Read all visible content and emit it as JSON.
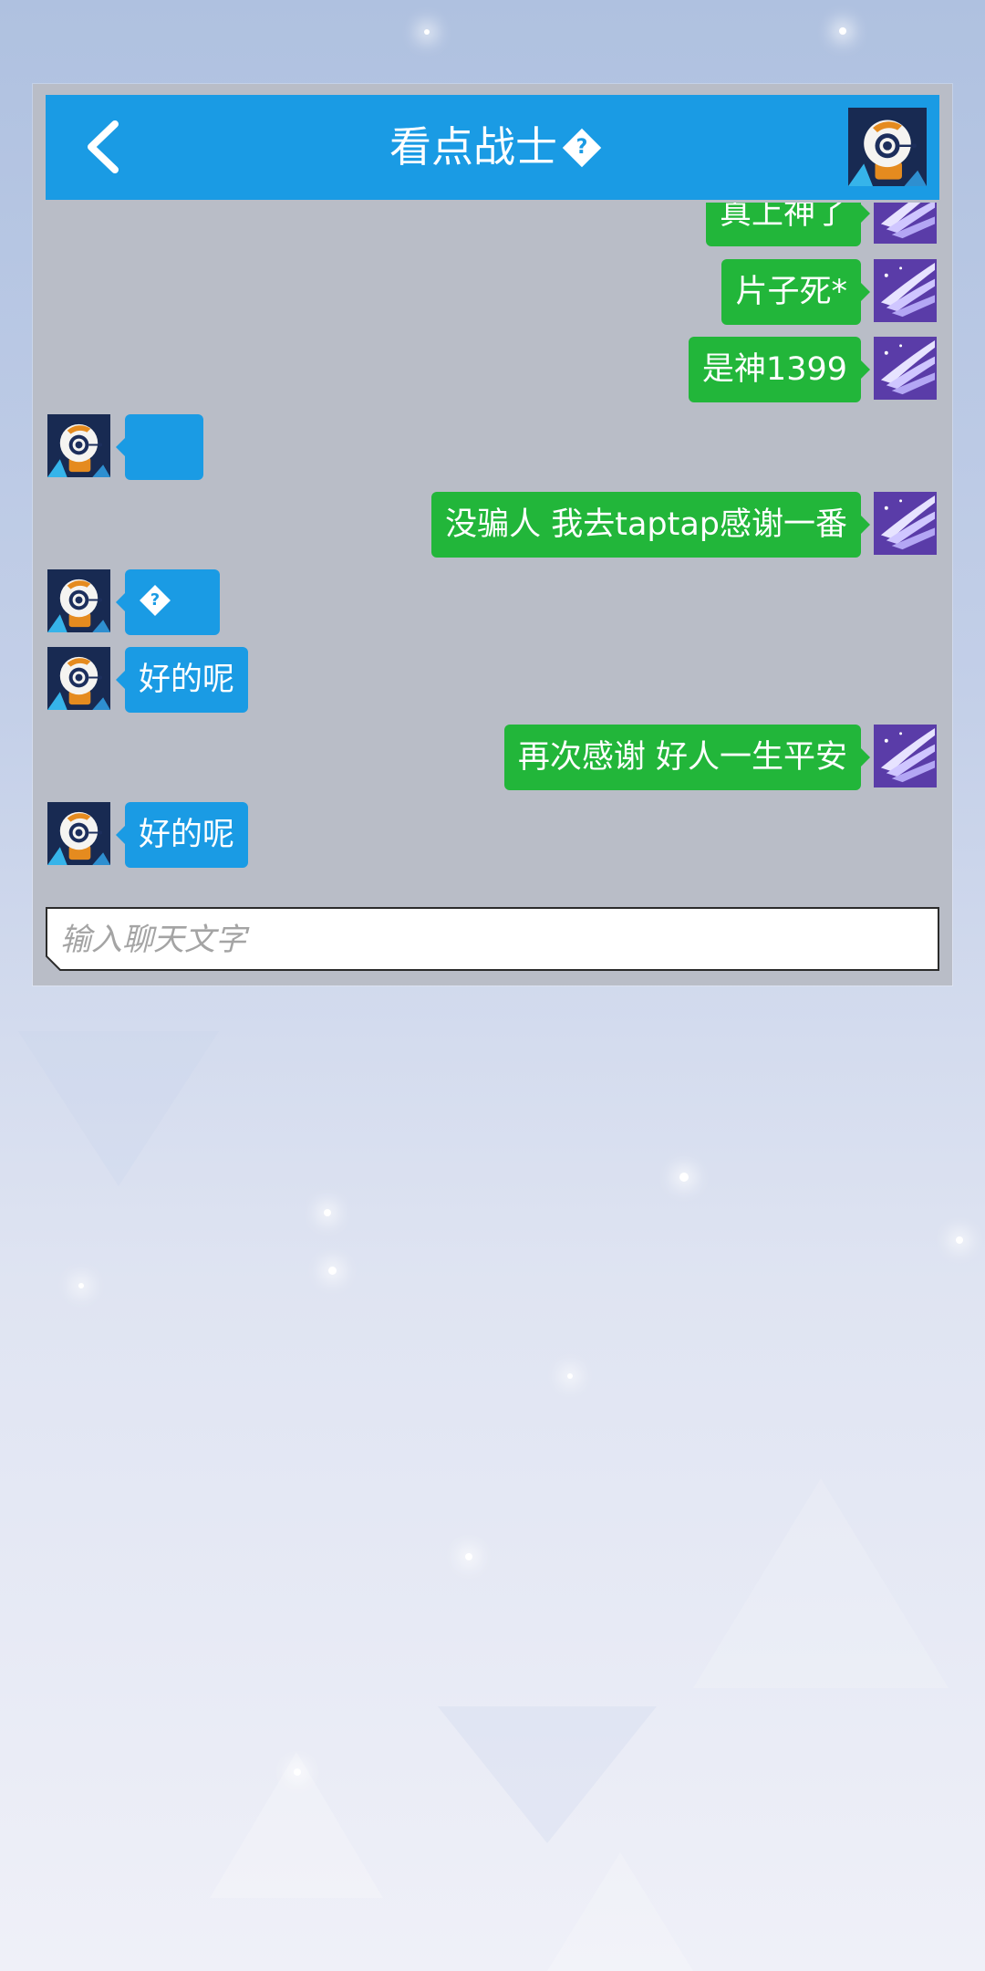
{
  "header": {
    "title": "看点战士",
    "title_mark": "?"
  },
  "input": {
    "placeholder": "输入聊天文字"
  },
  "colors": {
    "header_blue": "#1a9be4",
    "bubble_incoming": "#1a9be4",
    "bubble_outgoing": "#22b63a",
    "panel_bg": "#b9bdc7"
  },
  "icons": {
    "back": "chevron-left-icon",
    "contact_avatar": "robot-avatar-icon",
    "self_avatar": "purple-wing-avatar-icon"
  },
  "messages": [
    {
      "side": "right",
      "text": "真上神了"
    },
    {
      "side": "right",
      "text": "片子死*"
    },
    {
      "side": "right",
      "text": "是神1399"
    },
    {
      "side": "left",
      "text": ""
    },
    {
      "side": "right",
      "text": "没骗人 我去taptap感谢一番"
    },
    {
      "side": "left",
      "text": "",
      "mark": "?"
    },
    {
      "side": "left",
      "text": "好的呢"
    },
    {
      "side": "right",
      "text": "再次感谢 好人一生平安"
    },
    {
      "side": "left",
      "text": "好的呢"
    }
  ]
}
